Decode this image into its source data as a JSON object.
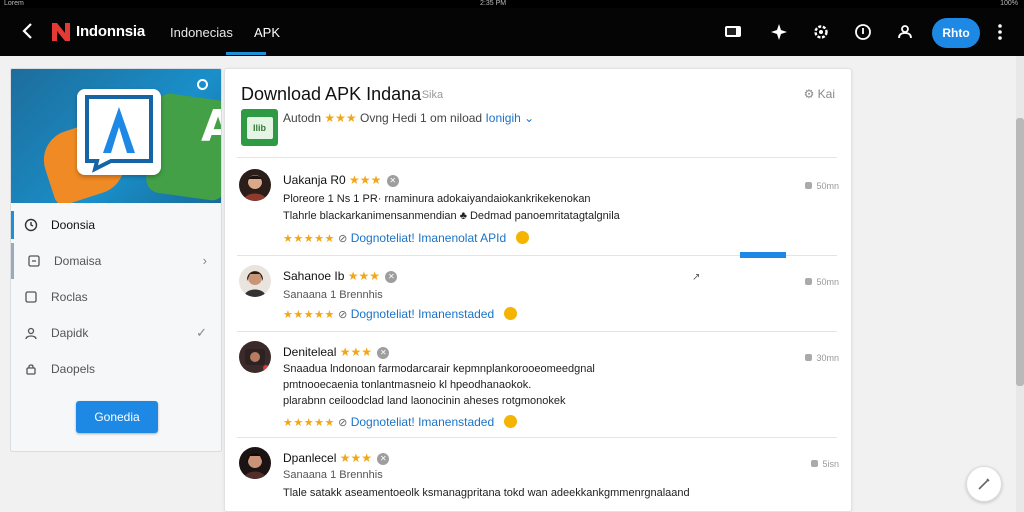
{
  "status": {
    "left": "Lorem",
    "center": "2:35 PM",
    "right": "100%"
  },
  "topbar": {
    "brand": "Indonnsia",
    "nav": [
      "Indonecias",
      "APK"
    ],
    "primary_button": "Rhto",
    "icons": [
      "back-icon",
      "cast-icon",
      "sparkle-icon",
      "settings-icon",
      "info-icon",
      "account-icon",
      "more-icon"
    ]
  },
  "sidebar": {
    "items": [
      {
        "label": "Doonsia",
        "icon": "clock-icon"
      },
      {
        "label": "Domaisa",
        "icon": "square-icon"
      },
      {
        "label": "Roclas",
        "icon": "image-icon"
      },
      {
        "label": "Dapidk",
        "icon": "person-icon"
      },
      {
        "label": "Daopels",
        "icon": "lock-icon"
      }
    ],
    "cta": "Gonedia"
  },
  "card": {
    "title": "Download APK Indana",
    "title_sub": "· Sika",
    "top_right": "⚙ Kai",
    "subtitle_prefix": "Autodn",
    "subtitle_stars": "★★★",
    "subtitle_text": "Ovng Hedi 1 om niload",
    "subtitle_link": "Ionigih ⌄",
    "app_icon_text": "Ilib"
  },
  "reviews": [
    {
      "name": "Uakanja R0",
      "stars": "★★★",
      "lines": [
        "Ploreore 1 Ns 1 PR· rnaminura adokaiyandaiokankrikekenokan",
        "Tlahrle blackarkanimensanmendian  ♣ Dedmad panoemritatagtalgnila"
      ],
      "foot_stars": "★★★★★",
      "foot_link": "Dognoteliat! Imanenolat APId",
      "time": "50mn"
    },
    {
      "name": "Sahanoe Ib",
      "stars": "★★★",
      "lines": [
        "Sanaana 1 Brennhis"
      ],
      "foot_stars": "★★★★★",
      "foot_link": "Dognoteliat! Imanenstaded",
      "time": "50mn"
    },
    {
      "name": "Deniteleal",
      "stars": "★★★",
      "lines": [
        "Snaadua lndonoan farmodarcarair kepmnplankorooeomeedgnal",
        "pmtnooecaenia tonlantmasneio kl hpeodhanaokok.",
        "plarabnn ceiloodclad land laonocinin  aheses rotgmonokek"
      ],
      "foot_stars": "★★★★★",
      "foot_link": "Dognoteliat! Imanenstaded",
      "time": "30mn"
    },
    {
      "name": "Dpanlecel",
      "stars": "★★★",
      "lines": [
        "Sanaana 1 Brennhis",
        "Tlale satakk aseamentoeolk ksmanagpritana tokd wan adeekkankgmmenrgnalaand"
      ],
      "time": "5isn"
    }
  ]
}
